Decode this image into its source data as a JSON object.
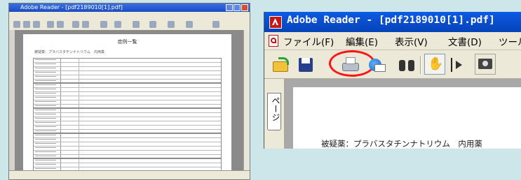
{
  "thumbnail": {
    "window_title": "Adobe Reader - [pdf2189010[1].pdf]",
    "page_title": "症例一覧",
    "page_subtitle": "被疑薬：プラバスタチンナトリウム　内用薬"
  },
  "reader": {
    "window_title": "Adobe Reader - [pdf2189010[1].pdf]",
    "menu": [
      {
        "label": "ファイル(F)"
      },
      {
        "label": "編集(E)"
      },
      {
        "label": "表示(V)"
      },
      {
        "label": "文書(D)"
      },
      {
        "label": "ツール"
      }
    ],
    "toolbar_icons": [
      "open-folder-icon",
      "save-icon",
      "print-icon",
      "email-icon",
      "search-binoculars-icon",
      "hand-icon",
      "select-text-icon",
      "camera-icon"
    ],
    "nav_tab_label": "ページ",
    "document_text": "被疑薬：プラバスタチンナトリウム　内用薬",
    "highlight_color": "#ff1414",
    "titlebar_color": "#0b4fd0"
  }
}
